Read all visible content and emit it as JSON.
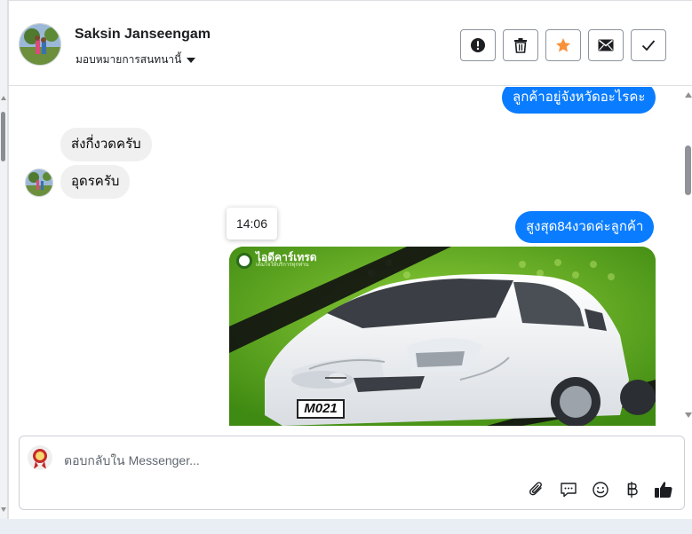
{
  "header": {
    "contact_name": "Saksin Janseengam",
    "assign_label": "มอบหมายการสนทนานี้",
    "actions": [
      {
        "name": "report",
        "icon": "alert-circle-icon"
      },
      {
        "name": "delete",
        "icon": "trash-icon"
      },
      {
        "name": "star",
        "icon": "star-icon",
        "color": "#f7923a"
      },
      {
        "name": "mark-unread",
        "icon": "envelope-icon"
      },
      {
        "name": "done",
        "icon": "check-icon"
      }
    ]
  },
  "conversation": {
    "messages": [
      {
        "direction": "outgoing",
        "text": "ลูกค้าอยู่จังหวัดอะไรคะ"
      },
      {
        "direction": "incoming",
        "text": "ส่งกี่งวดครับ"
      },
      {
        "direction": "incoming",
        "text": "อุดรครับ"
      },
      {
        "direction": "outgoing",
        "text": "สูงสุด84งวดค่ะลูกค้า"
      }
    ],
    "timestamp_tooltip": "14:06",
    "image": {
      "plate_text": "M021",
      "brand_text": "ไอดีคาร์เทรด",
      "brand_sub": "เต็มใจให้บริการทุกท่าน"
    }
  },
  "composer": {
    "placeholder": "ตอบกลับใน Messenger...",
    "tools": [
      "paperclip-icon",
      "speech-bubble-icon",
      "smiley-icon",
      "baht-icon",
      "thumbs-up-icon"
    ]
  },
  "colors": {
    "outgoing_bubble": "#0a7cff",
    "incoming_bubble": "#f0f0f0",
    "star": "#f7923a"
  }
}
